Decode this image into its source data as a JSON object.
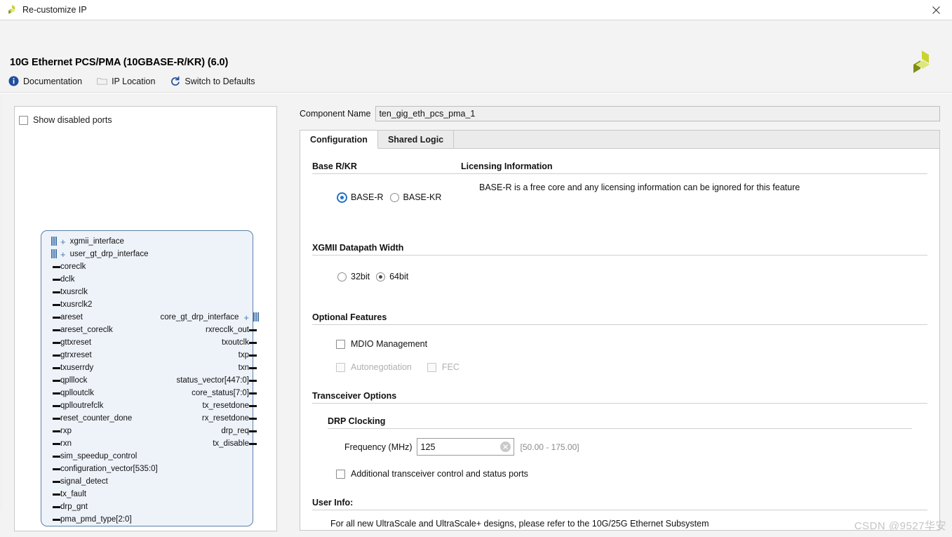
{
  "window": {
    "title": "Re-customize IP",
    "icon": "xilinx-logo-icon",
    "close_label": "✕"
  },
  "header": {
    "title": "10G Ethernet PCS/PMA (10GBASE-R/KR) (6.0)",
    "logo": "xilinx-logo-icon",
    "toolbar": [
      {
        "label": "Documentation",
        "icon": "info-icon"
      },
      {
        "label": "IP Location",
        "icon": "folder-icon"
      },
      {
        "label": "Switch to Defaults",
        "icon": "refresh-icon"
      }
    ]
  },
  "port_panel": {
    "show_disabled_ports": {
      "label": "Show disabled ports",
      "checked": false
    },
    "left_ports": [
      {
        "name": "xgmii_interface",
        "type": "bus"
      },
      {
        "name": "user_gt_drp_interface",
        "type": "bus"
      },
      {
        "name": "coreclk",
        "type": "pin"
      },
      {
        "name": "dclk",
        "type": "pin"
      },
      {
        "name": "txusrclk",
        "type": "pin"
      },
      {
        "name": "txusrclk2",
        "type": "pin"
      },
      {
        "name": "areset",
        "type": "pin"
      },
      {
        "name": "areset_coreclk",
        "type": "pin"
      },
      {
        "name": "gttxreset",
        "type": "pin"
      },
      {
        "name": "gtrxreset",
        "type": "pin"
      },
      {
        "name": "txuserrdy",
        "type": "pin"
      },
      {
        "name": "qplllock",
        "type": "pin"
      },
      {
        "name": "qplloutclk",
        "type": "pin"
      },
      {
        "name": "qplloutrefclk",
        "type": "pin"
      },
      {
        "name": "reset_counter_done",
        "type": "pin"
      },
      {
        "name": "rxp",
        "type": "pin"
      },
      {
        "name": "rxn",
        "type": "pin"
      },
      {
        "name": "sim_speedup_control",
        "type": "pin"
      },
      {
        "name": "configuration_vector[535:0]",
        "type": "pin"
      },
      {
        "name": "signal_detect",
        "type": "pin"
      },
      {
        "name": "tx_fault",
        "type": "pin"
      },
      {
        "name": "drp_gnt",
        "type": "pin"
      },
      {
        "name": "pma_pmd_type[2:0]",
        "type": "pin"
      }
    ],
    "right_ports": [
      {
        "name": "core_gt_drp_interface",
        "type": "bus",
        "row": 6
      },
      {
        "name": "rxrecclk_out",
        "type": "pin",
        "row": 7
      },
      {
        "name": "txoutclk",
        "type": "pin",
        "row": 8
      },
      {
        "name": "txp",
        "type": "pin",
        "row": 9
      },
      {
        "name": "txn",
        "type": "pin",
        "row": 10
      },
      {
        "name": "status_vector[447:0]",
        "type": "pin",
        "row": 11
      },
      {
        "name": "core_status[7:0]",
        "type": "pin",
        "row": 12
      },
      {
        "name": "tx_resetdone",
        "type": "pin",
        "row": 13
      },
      {
        "name": "rx_resetdone",
        "type": "pin",
        "row": 14
      },
      {
        "name": "drp_req",
        "type": "pin",
        "row": 15
      },
      {
        "name": "tx_disable",
        "type": "pin",
        "row": 16
      }
    ]
  },
  "right_panel": {
    "component_name": {
      "label": "Component Name",
      "value": "ten_gig_eth_pcs_pma_1"
    },
    "tabs": [
      {
        "label": "Configuration",
        "active": true
      },
      {
        "label": "Shared Logic",
        "active": false
      }
    ],
    "base_rkr": {
      "title": "Base R/KR",
      "options": [
        {
          "label": "BASE-R",
          "selected": true
        },
        {
          "label": "BASE-KR",
          "selected": false
        }
      ]
    },
    "licensing": {
      "title": "Licensing Information",
      "text": "BASE-R is a free core and any licensing information can be ignored for this feature"
    },
    "xgmii": {
      "title": "XGMII Datapath Width",
      "options": [
        {
          "label": "32bit",
          "selected": false
        },
        {
          "label": "64bit",
          "selected": true
        }
      ]
    },
    "optional_features": {
      "title": "Optional Features",
      "items": [
        {
          "label": "MDIO Management",
          "checked": false,
          "disabled": false
        },
        {
          "label": "Autonegotiation",
          "checked": false,
          "disabled": true
        },
        {
          "label": "FEC",
          "checked": false,
          "disabled": true
        }
      ]
    },
    "transceiver_options": {
      "title": "Transceiver Options",
      "drp_clocking": {
        "title": "DRP Clocking",
        "frequency_label": "Frequency (MHz)",
        "frequency_value": "125",
        "frequency_range": "[50.00 - 175.00]",
        "clear_icon": "clear-circle-icon"
      },
      "additional_ports": {
        "label": "Additional transceiver control and status ports",
        "checked": false
      }
    },
    "user_info": {
      "title": "User Info:",
      "text": "For all new UltraScale and UltraScale+ designs, please refer to the 10G/25G Ethernet Subsystem"
    }
  },
  "watermark": "CSDN @9527华安",
  "colors": {
    "accent_blue": "#2273c4",
    "link_blue": "#1f4e9c",
    "logo_olive": "#7f8c1a",
    "logo_yellow": "#c8d430",
    "logo_light": "#dde77a",
    "block_fill": "#eef3fa",
    "block_border": "#5b7fa6"
  }
}
